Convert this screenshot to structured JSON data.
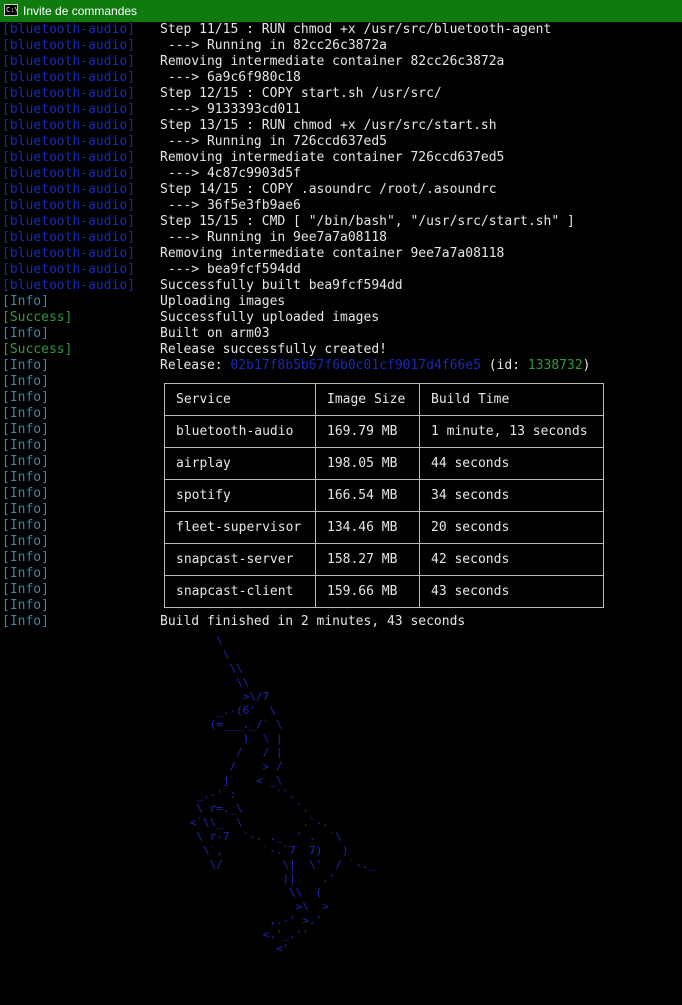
{
  "window": {
    "title": "Invite de commandes",
    "icon_text": "C:\\"
  },
  "colors": {
    "title_bar": "#0f7b0f",
    "builder_prefix": "#1a2ab4",
    "info_prefix": "#3d85a6",
    "success_prefix": "#2f9a3a",
    "text": "#e6e6e6"
  },
  "log_lines": [
    {
      "prefix": "[bluetooth-audio]",
      "kind": "builder",
      "text": "Step 11/15 : RUN chmod +x /usr/src/bluetooth-agent"
    },
    {
      "prefix": "[bluetooth-audio]",
      "kind": "builder",
      "text": " ---> Running in 82cc26c3872a"
    },
    {
      "prefix": "[bluetooth-audio]",
      "kind": "builder",
      "text": "Removing intermediate container 82cc26c3872a"
    },
    {
      "prefix": "[bluetooth-audio]",
      "kind": "builder",
      "text": " ---> 6a9c6f980c18"
    },
    {
      "prefix": "[bluetooth-audio]",
      "kind": "builder",
      "text": "Step 12/15 : COPY start.sh /usr/src/"
    },
    {
      "prefix": "[bluetooth-audio]",
      "kind": "builder",
      "text": " ---> 9133393cd011"
    },
    {
      "prefix": "[bluetooth-audio]",
      "kind": "builder",
      "text": "Step 13/15 : RUN chmod +x /usr/src/start.sh"
    },
    {
      "prefix": "[bluetooth-audio]",
      "kind": "builder",
      "text": " ---> Running in 726ccd637ed5"
    },
    {
      "prefix": "[bluetooth-audio]",
      "kind": "builder",
      "text": "Removing intermediate container 726ccd637ed5"
    },
    {
      "prefix": "[bluetooth-audio]",
      "kind": "builder",
      "text": " ---> 4c87c9903d5f"
    },
    {
      "prefix": "[bluetooth-audio]",
      "kind": "builder",
      "text": "Step 14/15 : COPY .asoundrc /root/.asoundrc"
    },
    {
      "prefix": "[bluetooth-audio]",
      "kind": "builder",
      "text": " ---> 36f5e3fb9ae6"
    },
    {
      "prefix": "[bluetooth-audio]",
      "kind": "builder",
      "text": "Step 15/15 : CMD [ \"/bin/bash\", \"/usr/src/start.sh\" ]"
    },
    {
      "prefix": "[bluetooth-audio]",
      "kind": "builder",
      "text": " ---> Running in 9ee7a7a08118"
    },
    {
      "prefix": "[bluetooth-audio]",
      "kind": "builder",
      "text": "Removing intermediate container 9ee7a7a08118"
    },
    {
      "prefix": "[bluetooth-audio]",
      "kind": "builder",
      "text": " ---> bea9fcf594dd"
    },
    {
      "prefix": "[bluetooth-audio]",
      "kind": "builder",
      "text": "Successfully built bea9fcf594dd"
    },
    {
      "prefix": "[Info]",
      "kind": "info",
      "text": "Uploading images"
    },
    {
      "prefix": "[Success]",
      "kind": "success",
      "text": "Successfully uploaded images"
    },
    {
      "prefix": "[Info]",
      "kind": "info",
      "text": "Built on arm03"
    },
    {
      "prefix": "[Success]",
      "kind": "success",
      "text": "Release successfully created!"
    }
  ],
  "release_line": {
    "prefix": "[Info]",
    "label": "Release: ",
    "hash": "02b17f8b5b67f6b0c01cf9017d4f66e5",
    "id_label": " (id: ",
    "id_value": "1338732",
    "id_close": ")"
  },
  "info_column_prefix": "[Info]",
  "build_table": {
    "headers": [
      "Service",
      "Image Size",
      "Build Time"
    ],
    "rows": [
      [
        "bluetooth-audio",
        "169.79 MB",
        "1 minute, 13 seconds"
      ],
      [
        "airplay",
        "198.05 MB",
        "44 seconds"
      ],
      [
        "spotify",
        "166.54 MB",
        "34 seconds"
      ],
      [
        "fleet-supervisor",
        "134.46 MB",
        "20 seconds"
      ],
      [
        "snapcast-server",
        "158.27 MB",
        "42 seconds"
      ],
      [
        "snapcast-client",
        "159.66 MB",
        "43 seconds"
      ]
    ]
  },
  "final_line": {
    "prefix": "[Info]",
    "text": "Build finished in 2 minutes, 43 seconds"
  },
  "unicorn_art": "          \\\n           \\\n            \\\\\n             \\\\\n              >\\/7\n          _.-(6'  \\\n         (=___._/` \\\n              )  \\ |\n             /   / |\n            /    > /\n           j    < _\\\n       _.-' :      ``.\n       \\ r=._\\        `.\n      <`\\\\_  \\         .`-.\n       \\ r-7  `-. ._  ' .  `\\\n        \\`,      `-.`7  7)   )\n         \\/         \\|  \\'  / `-._\n                    ||    .'\n                     \\\\  (\n                      >\\  >\n                  ,.-' >.'\n                 <.'_.''\n                   <'"
}
